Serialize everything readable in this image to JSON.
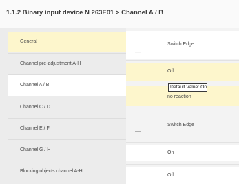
{
  "header": {
    "title": "1.1.2 Binary input device N 263E01 > Channel A / B"
  },
  "sidebar": {
    "items": [
      {
        "label": "General"
      },
      {
        "label": "Channel pre-adjustment A-H"
      },
      {
        "label": "Channel A / B"
      },
      {
        "label": "Channel C / D"
      },
      {
        "label": "Channel E / F"
      },
      {
        "label": "Channel G / H"
      },
      {
        "label": "Blocking objects channel A-H"
      }
    ]
  },
  "parameters": {
    "dash": "—",
    "switch_edge_1": "Switch Edge",
    "value_off_1": "Off",
    "value_no_reaction": "no reaction",
    "switch_edge_2": "Switch Edge",
    "value_on": "On",
    "value_off_2": "Off"
  },
  "tooltip": {
    "text": "Default Value: On"
  }
}
